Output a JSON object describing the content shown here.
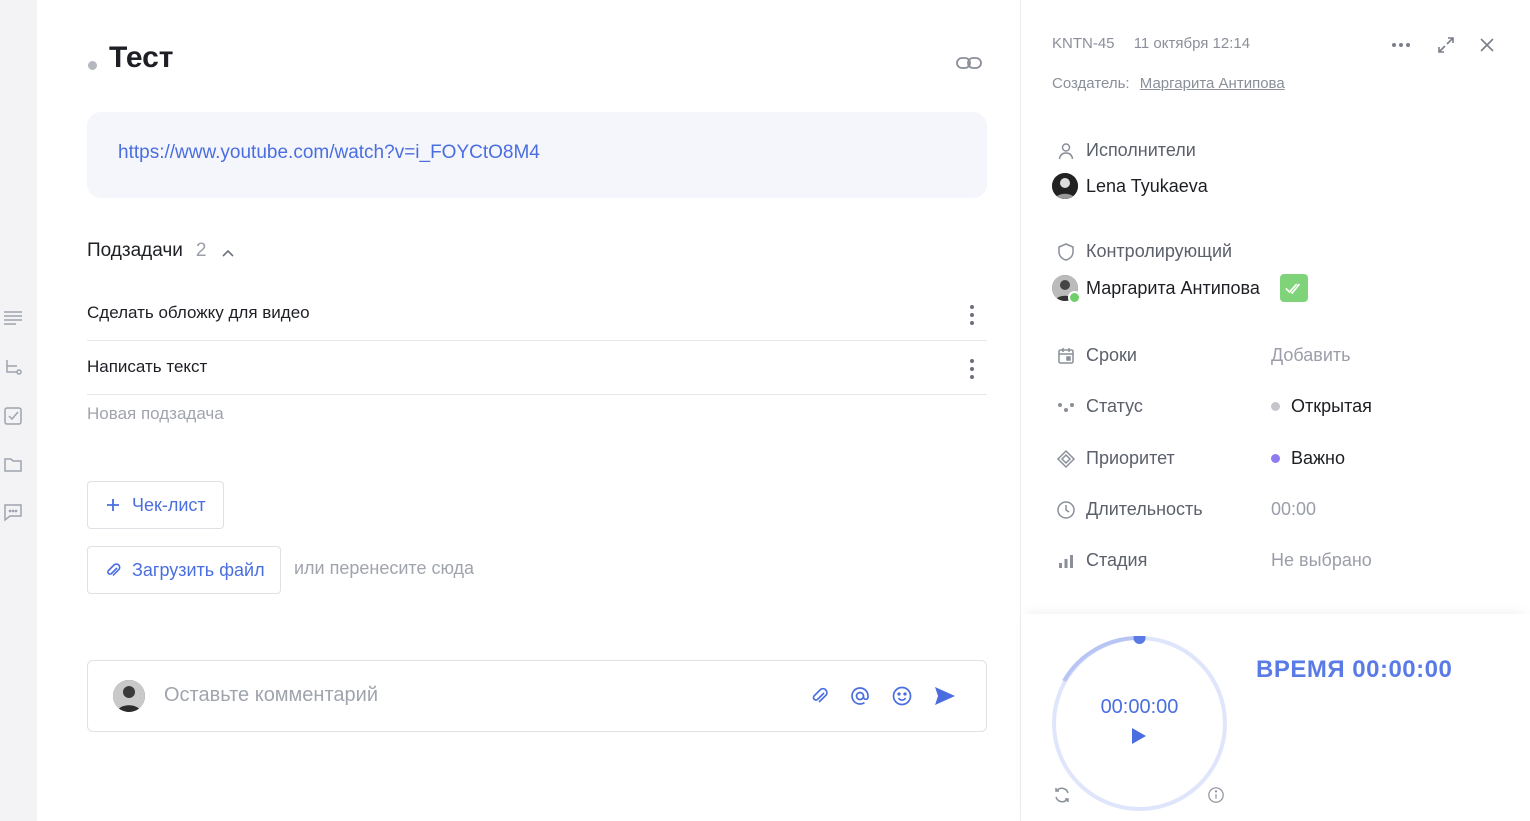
{
  "task": {
    "title": "Тест",
    "description_link": "https://www.youtube.com/watch?v=i_FOYCtO8M4"
  },
  "subtasks": {
    "header": "Подзадачи",
    "count": "2",
    "items": [
      {
        "label": "Сделать обложку для видео"
      },
      {
        "label": "Написать текст"
      }
    ],
    "new_placeholder": "Новая подзадача"
  },
  "actions": {
    "checklist_label": "Чек-лист",
    "upload_label": "Загрузить файл",
    "upload_hint": "или перенесите сюда"
  },
  "comment": {
    "placeholder": "Оставьте комментарий"
  },
  "panel": {
    "task_id": "KNTN-45",
    "created_at": "11 октября 12:14",
    "creator_label": "Создатель:",
    "creator_name": "Маргарита Антипова",
    "assignees_label": "Исполнители",
    "assignee_name": "Lena Tyukaeva",
    "controller_label": "Контролирующий",
    "controller_name": "Маргарита Антипова",
    "props": [
      {
        "label": "Сроки",
        "value": "Добавить",
        "icon": "calendar-icon"
      },
      {
        "label": "Статус",
        "value": "Открытая",
        "icon": "status-icon",
        "dot": "#c4c6cc"
      },
      {
        "label": "Приоритет",
        "value": "Важно",
        "icon": "priority-icon",
        "dot": "#8f7bf0"
      },
      {
        "label": "Длительность",
        "value": "00:00",
        "icon": "clock-icon"
      },
      {
        "label": "Стадия",
        "value": "Не выбрано",
        "icon": "stage-icon"
      }
    ]
  },
  "timer": {
    "display": "00:00:00",
    "total_label": "ВРЕМЯ 00:00:00"
  },
  "colors": {
    "accent": "#4a6ee0",
    "approve": "#7fd47a"
  }
}
